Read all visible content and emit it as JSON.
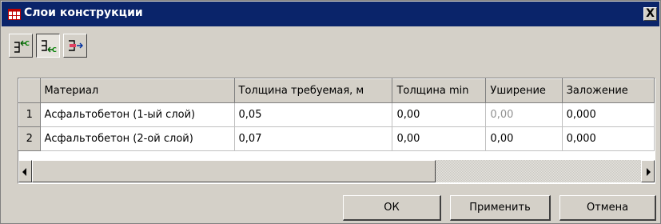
{
  "window": {
    "title": "Слои конструкции",
    "close_label": "X"
  },
  "toolbar": {
    "buttons": [
      {
        "name": "add-layer-button",
        "pressed": false
      },
      {
        "name": "insert-layer-button",
        "pressed": true
      },
      {
        "name": "layer-properties-button",
        "pressed": false
      }
    ]
  },
  "grid": {
    "columns": [
      "Материал",
      "Толщина требуемая, м",
      "Толщина min",
      "Уширение",
      "Заложение"
    ],
    "rows": [
      {
        "num": "1",
        "material": "Асфальтобетон (1-ый слой)",
        "thickness": "0,05",
        "thickness_min": "0,00",
        "widening": "0,00",
        "slope": "0,000"
      },
      {
        "num": "2",
        "material": "Асфальтобетон (2-ой слой)",
        "thickness": "0,07",
        "thickness_min": "0,00",
        "widening": "0,00",
        "slope": "0,000"
      }
    ],
    "scroll_position_fraction": 0
  },
  "buttons": {
    "ok": "ОК",
    "apply": "Применить",
    "cancel": "Отмена"
  },
  "colors": {
    "titlebar": "#0a246a",
    "face": "#d4d0c8",
    "dim_text": "#909090"
  }
}
